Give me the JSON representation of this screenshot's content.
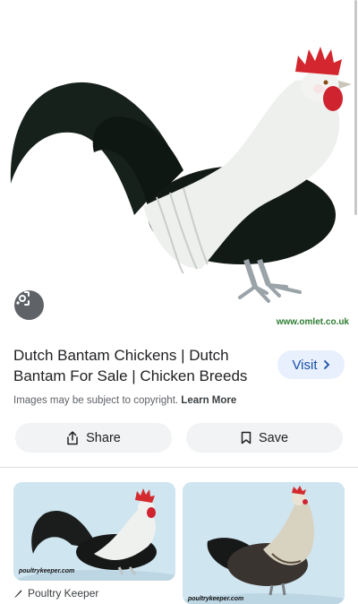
{
  "hero": {
    "watermark": "www.omlet.co.uk",
    "lens_icon": "google-lens-icon"
  },
  "result": {
    "title": "Dutch Bantam Chickens | Dutch Bantam For Sale | Chicken Breeds",
    "visit_label": "Visit",
    "copyright_text": "Images may be subject to copyright.",
    "learn_more": "Learn More"
  },
  "actions": {
    "share_label": "Share",
    "save_label": "Save",
    "share_icon": "share-icon",
    "save_icon": "bookmark-icon"
  },
  "related": {
    "items": [
      {
        "watermark": "poultrykeeper.com",
        "source": "Poultry Keeper"
      },
      {
        "watermark": "poultrykeeper.com"
      }
    ]
  },
  "colors": {
    "visit_bg": "#e8f0fe",
    "visit_text": "#174ea6",
    "button_bg": "#f1f3f4",
    "card_bg": "#cde3ef"
  }
}
